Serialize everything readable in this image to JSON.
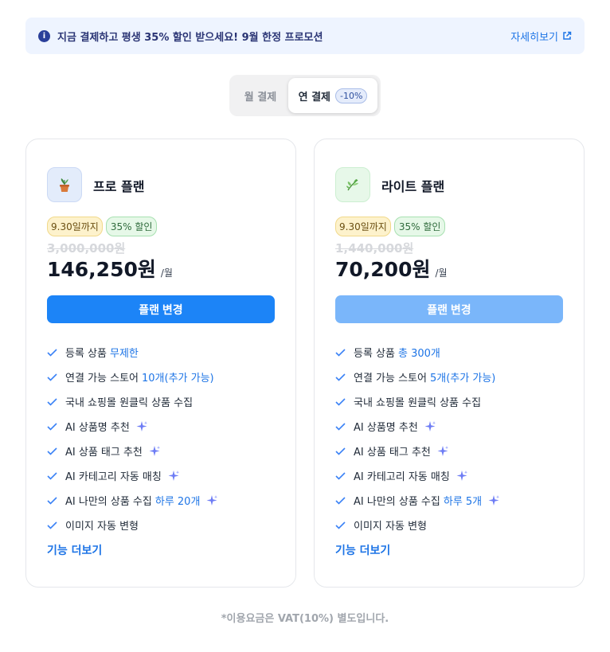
{
  "banner": {
    "info_icon": "i",
    "text": "지금 결제하고 평생 35% 할인 받으세요! 9월 한정 프로모션",
    "link_label": "자세히보기",
    "link_icon": "external-link-icon"
  },
  "billing_toggle": {
    "monthly_label": "월 결제",
    "yearly_label": "연 결제",
    "yearly_badge": "-10%",
    "selected": "yearly"
  },
  "plans": [
    {
      "name": "프로 플랜",
      "icon": "potted-plant-icon",
      "deadline_badge": "9.30일까지",
      "discount_badge": "35% 할인",
      "original_price": "3,000,000원",
      "price": "146,250원",
      "price_unit": "/월",
      "cta_label": "플랜 변경",
      "features": [
        {
          "text": "등록 상품",
          "highlight": "무제한",
          "sparkle": false
        },
        {
          "text": "연결 가능 스토어",
          "highlight": "10개(추가 가능)",
          "sparkle": false
        },
        {
          "text": "국내 쇼핑몰 원클릭 상품 수집",
          "highlight": "",
          "sparkle": false
        },
        {
          "text": "AI 상품명 추천",
          "highlight": "",
          "sparkle": true
        },
        {
          "text": "AI 상품 태그 추천",
          "highlight": "",
          "sparkle": true
        },
        {
          "text": "AI 카테고리 자동 매칭",
          "highlight": "",
          "sparkle": true
        },
        {
          "text": "AI 나만의 상품 수집",
          "highlight": "하루 20개",
          "sparkle": true
        },
        {
          "text": "이미지 자동 변형",
          "highlight": "",
          "sparkle": false
        }
      ],
      "more_label": "기능 더보기"
    },
    {
      "name": "라이트 플랜",
      "icon": "leaf-icon",
      "deadline_badge": "9.30일까지",
      "discount_badge": "35% 할인",
      "original_price": "1,440,000원",
      "price": "70,200원",
      "price_unit": "/월",
      "cta_label": "플랜 변경",
      "features": [
        {
          "text": "등록 상품",
          "highlight": "총 300개",
          "sparkle": false
        },
        {
          "text": "연결 가능 스토어",
          "highlight": "5개(추가 가능)",
          "sparkle": false
        },
        {
          "text": "국내 쇼핑몰 원클릭 상품 수집",
          "highlight": "",
          "sparkle": false
        },
        {
          "text": "AI 상품명 추천",
          "highlight": "",
          "sparkle": true
        },
        {
          "text": "AI 상품 태그 추천",
          "highlight": "",
          "sparkle": true
        },
        {
          "text": "AI 카테고리 자동 매칭",
          "highlight": "",
          "sparkle": true
        },
        {
          "text": "AI 나만의 상품 수집",
          "highlight": "하루 5개",
          "sparkle": true
        },
        {
          "text": "이미지 자동 변형",
          "highlight": "",
          "sparkle": false
        }
      ],
      "more_label": "기능 더보기"
    }
  ],
  "footnote": "*이용요금은 VAT(10%) 별도입니다.",
  "colors": {
    "accent": "#1d74e6",
    "primary_button": "#1c84f7",
    "secondary_button": "#7ab6fa",
    "banner_bg": "#eef4ff"
  }
}
